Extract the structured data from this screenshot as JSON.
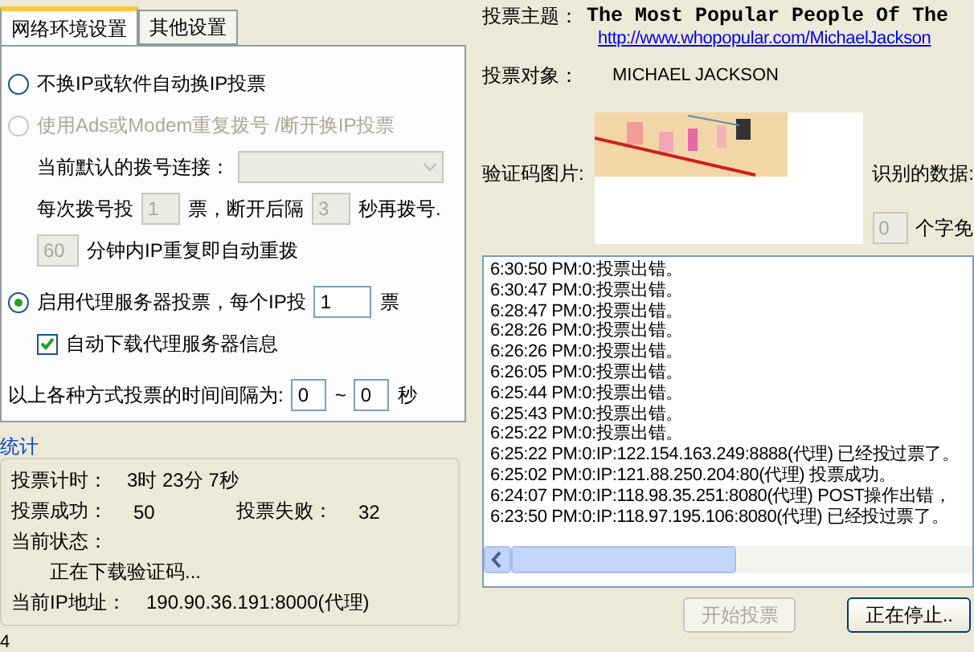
{
  "tabs": [
    {
      "label": "网络环境设置",
      "selected": true
    },
    {
      "label": "其他设置",
      "selected": false
    }
  ],
  "change_ip_option": {
    "label": "不换IP或软件自动换IP投票",
    "selected": false
  },
  "dial_option": {
    "label": "使用Ads或Modem重复拨号 /断开换IP投票",
    "selected": false,
    "disabled": true
  },
  "dial": {
    "disabled": true,
    "connection_label": "当前默认的拨号连接：",
    "votes_label": "每次拨号投",
    "votes": "1",
    "after_label": "票，断开后隔",
    "seconds": "3",
    "redial_label": "秒再拨号.",
    "minutes": "60",
    "minutes_label": "分钟内IP重复即自动重拨"
  },
  "proxy_option": {
    "label": "启用代理服务器投票，每个IP投",
    "selected": true,
    "votes": "1",
    "unit": "票"
  },
  "auto_download": {
    "label": "自动下载代理服务器信息",
    "checked": true
  },
  "interval": {
    "label": "以上各种方式投票的时间间隔为:",
    "from": "0",
    "separator": "~",
    "to": "0",
    "unit": "秒"
  },
  "stats": {
    "title": "统计",
    "timer_label": "投票计时：",
    "timer": "3时 23分 7秒",
    "success_label": "投票成功：",
    "success": "50",
    "fail_label": "投票失败：",
    "fail": "32",
    "status_label": "当前状态：",
    "status": "正在下载验证码...",
    "ip_label": "当前IP地址：",
    "ip": "190.90.36.191:8000(代理)"
  },
  "status_fragment": "4",
  "topic": {
    "label": "投票主题：",
    "title": "The Most Popular People Of The",
    "url": "http://www.whopopular.com/MichaelJackson"
  },
  "target": {
    "label": "投票对象：",
    "value": "MICHAEL JACKSON"
  },
  "captcha": {
    "label": "验证码图片:",
    "recognized_label": "识别的数据:",
    "count": "0",
    "count_label": "个字免"
  },
  "log": [
    "6:30:50 PM:0:投票出错。",
    "6:30:47 PM:0:投票出错。",
    "6:28:47 PM:0:投票出错。",
    "6:28:26 PM:0:投票出错。",
    "6:26:26 PM:0:投票出错。",
    "6:26:05 PM:0:投票出错。",
    "6:25:44 PM:0:投票出错。",
    "6:25:43 PM:0:投票出错。",
    "6:25:22 PM:0:投票出错。",
    "6:25:22 PM:0:IP:122.154.163.249:8888(代理) 已经投过票了。",
    "6:25:02 PM:0:IP:121.88.250.204:80(代理) 投票成功。",
    "6:24:07 PM:0:IP:118.98.35.251:8080(代理) POST操作出错，",
    "6:23:50 PM:0:IP:118.97.195.106:8080(代理) 已经投过票了。"
  ],
  "buttons": [
    {
      "label": "开始投票",
      "disabled": true
    },
    {
      "label": "正在停止..",
      "disabled": false
    }
  ]
}
